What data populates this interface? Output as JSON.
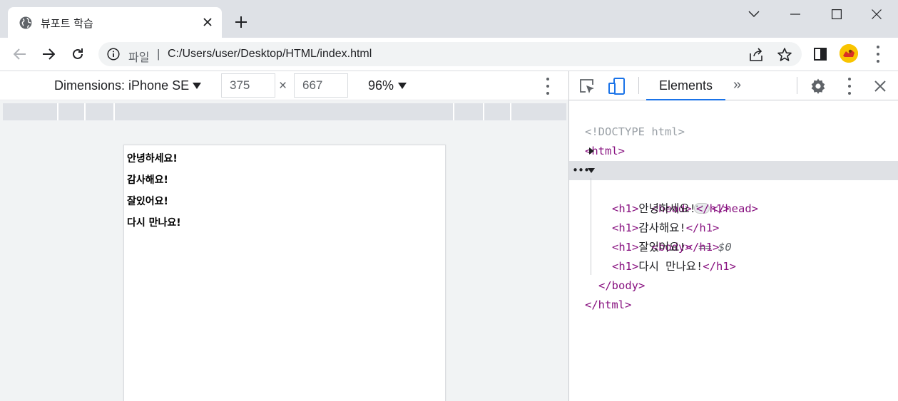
{
  "browser": {
    "tab_title": "뷰포트 학습",
    "url_scheme": "파일",
    "url_separator": "|",
    "url": "C:/Users/user/Desktop/HTML/index.html"
  },
  "device_toolbar": {
    "dimensions_label": "Dimensions: iPhone SE",
    "width_value": "375",
    "height_value": "667",
    "times_symbol": "×",
    "zoom_label": "96%"
  },
  "page": {
    "headings": [
      "안녕하세요!",
      "감사해요!",
      "잘있어요!",
      "다시 만나요!"
    ]
  },
  "devtools": {
    "active_tab": "Elements",
    "more_tabs": "»",
    "dom": {
      "doctype": "<!DOCTYPE html>",
      "html_open": "<html>",
      "head_open": "<head>",
      "head_close": "</head>",
      "body_open": "<body>",
      "body_marker": " == $0",
      "h1_open": "<h1>",
      "h1_close": "</h1>",
      "h1_texts": [
        "안녕하세요!",
        "감사해요!",
        "잘있어요!",
        "다시 만나요!"
      ],
      "body_close": "</body>",
      "html_close": "</html>"
    }
  },
  "colors": {
    "tag": "#881280",
    "accent": "#1a73e8",
    "tabstrip": "#dee1e6",
    "selected_row": "#dfe1e5"
  }
}
